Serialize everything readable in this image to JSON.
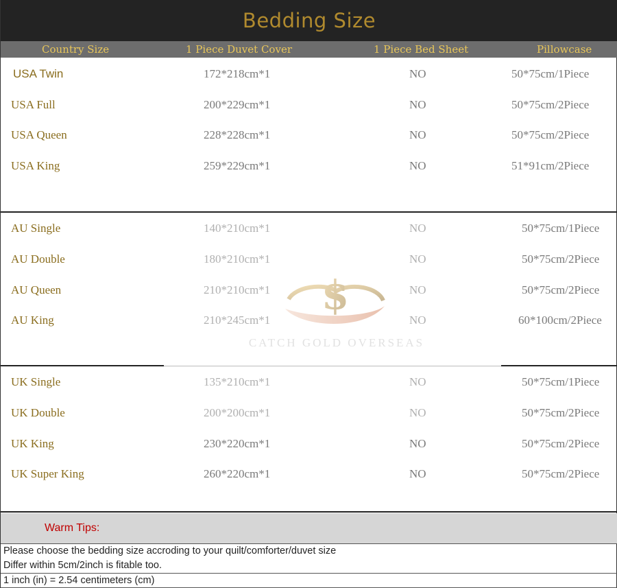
{
  "title": "Bedding Size",
  "columns": [
    "Country Size",
    "1 Piece Duvet Cover",
    "1 Piece Bed Sheet",
    "Pillowcase"
  ],
  "groups": [
    {
      "name": "USA",
      "rows": [
        {
          "size": "USA Twin",
          "duvet": "172*218cm*1",
          "sheet": "NO",
          "pillowcase": "50*75cm/1Piece"
        },
        {
          "size": "USA Full",
          "duvet": "200*229cm*1",
          "sheet": "NO",
          "pillowcase": "50*75cm/2Piece"
        },
        {
          "size": "USA Queen",
          "duvet": "228*228cm*1",
          "sheet": "NO",
          "pillowcase": "50*75cm/2Piece"
        },
        {
          "size": "USA King",
          "duvet": "259*229cm*1",
          "sheet": "NO",
          "pillowcase": "51*91cm/2Piece"
        }
      ]
    },
    {
      "name": "AU",
      "rows": [
        {
          "size": "AU Single",
          "duvet": "140*210cm*1",
          "sheet": "NO",
          "pillowcase": "50*75cm/1Piece"
        },
        {
          "size": "AU Double",
          "duvet": "180*210cm*1",
          "sheet": "NO",
          "pillowcase": "50*75cm/2Piece"
        },
        {
          "size": "AU Queen",
          "duvet": "210*210cm*1",
          "sheet": "NO",
          "pillowcase": "50*75cm/2Piece"
        },
        {
          "size": "AU King",
          "duvet": "210*245cm*1",
          "sheet": "NO",
          "pillowcase": "60*100cm/2Piece"
        }
      ]
    },
    {
      "name": "UK",
      "rows": [
        {
          "size": "UK Single",
          "duvet": "135*210cm*1",
          "sheet": "NO",
          "pillowcase": "50*75cm/1Piece"
        },
        {
          "size": "UK Double",
          "duvet": "200*200cm*1",
          "sheet": "NO",
          "pillowcase": "50*75cm/2Piece"
        },
        {
          "size": "UK King",
          "duvet": "230*220cm*1",
          "sheet": "NO",
          "pillowcase": "50*75cm/2Piece"
        },
        {
          "size": "UK Super King",
          "duvet": "260*220cm*1",
          "sheet": "NO",
          "pillowcase": "50*75cm/2Piece"
        }
      ]
    }
  ],
  "watermark": {
    "text": "CATCH GOLD OVERSEAS",
    "icon": "dollar-hands-logo-icon"
  },
  "tips": {
    "title": "Warm Tips:",
    "lines": [
      "Please choose the bedding size accroding to your quilt/comforter/duvet size",
      "Differ within 5cm/2inch is fitable too.",
      "1 inch (in) = 2.54 centimeters (cm)"
    ]
  },
  "colors": {
    "title_bar": "#232323",
    "title_text": "#b08a2e",
    "header_bar": "#6d6d6d",
    "header_text": "#e8c65a",
    "size_text": "#8a6d1e",
    "tips_title": "#c00000"
  }
}
